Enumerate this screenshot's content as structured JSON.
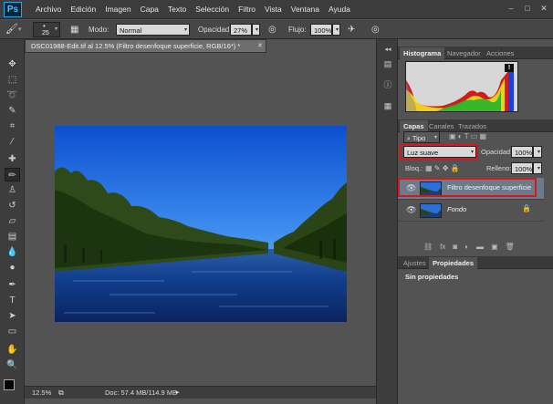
{
  "app": {
    "logo": "Ps"
  },
  "menu": [
    "Archivo",
    "Edición",
    "Imagen",
    "Capa",
    "Texto",
    "Selección",
    "Filtro",
    "Vista",
    "Ventana",
    "Ayuda"
  ],
  "window_controls": [
    "–",
    "□",
    "✕"
  ],
  "options": {
    "brush_size": "25",
    "mode_label": "Modo:",
    "mode_value": "Normal",
    "opacity_label": "Opacidad:",
    "opacity_value": "27%",
    "flow_label": "Flujo:",
    "flow_value": "100%"
  },
  "document": {
    "tab_title": "DSC01988-Edit.tif al 12.5% (Filtro desenfoque superficie, RGB/16*) *",
    "zoom": "12.5%",
    "doc_info": "Doc: 57.4 MB/114.9 MB"
  },
  "panels": {
    "top_tabs": [
      "Histograma",
      "Navegador",
      "Acciones"
    ],
    "layers_tabs": [
      "Capas",
      "Canales",
      "Trazados"
    ],
    "filter_kind": "Tipo",
    "blend_mode": "Luz suave",
    "opacity_label": "Opacidad:",
    "opacity_value": "100%",
    "lock_label": "Bloq.:",
    "fill_label": "Relleno:",
    "fill_value": "100%",
    "layers": [
      {
        "name": "Filtro desenfoque superficie",
        "selected": true
      },
      {
        "name": "Fondo",
        "selected": false,
        "locked": true
      }
    ],
    "bottom_tabs": [
      "Ajustes",
      "Propiedades"
    ],
    "properties_text": "Sin propiedades"
  },
  "colors": {
    "selection_highlight": "#d11a1a",
    "selected_layer": "#6c7a8c",
    "ps_accent": "#2ea3e6"
  },
  "histogram": {
    "warning": "!"
  }
}
